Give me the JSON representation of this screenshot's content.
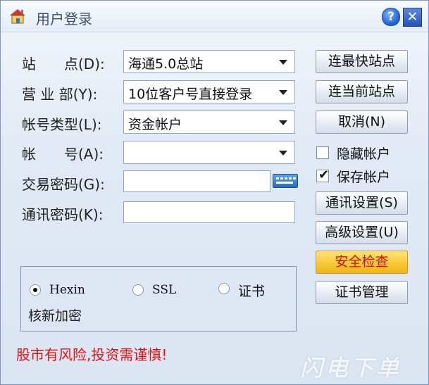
{
  "window": {
    "title": "用户登录",
    "help": "?",
    "close": "✕"
  },
  "form": {
    "station_label": "站　　点(D):",
    "station_value": "海通5.0总站",
    "department_label": "营 业 部(Y):",
    "department_value": "10位客户号直接登录",
    "account_type_label": "帐号类型(L):",
    "account_type_value": "资金帐户",
    "account_label": "帐　　号(A):",
    "account_value": "",
    "trade_password_label": "交易密码(G):",
    "comm_password_label": "通讯密码(K):"
  },
  "buttons": {
    "fastest_station": "连最快站点",
    "current_station": "连当前站点",
    "cancel": "取消(N)",
    "comm_settings": "通讯设置(S)",
    "advanced_settings": "高级设置(U)",
    "security_check": "安全检查",
    "cert_manage": "证书管理"
  },
  "options": {
    "hide_account": "隐藏帐户",
    "save_account": "保存帐户",
    "hide_account_checked": false,
    "save_account_checked": true
  },
  "encryption": {
    "hexin": "Hexin",
    "ssl": "SSL",
    "cert": "证书",
    "selected": "Hexin",
    "caption": "核新加密"
  },
  "footer": {
    "warning": "股市有风险,投资需谨慎!",
    "watermark": "闪电下单"
  },
  "colors": {
    "warning": "#e01010",
    "security_btn": "#f7c531"
  }
}
